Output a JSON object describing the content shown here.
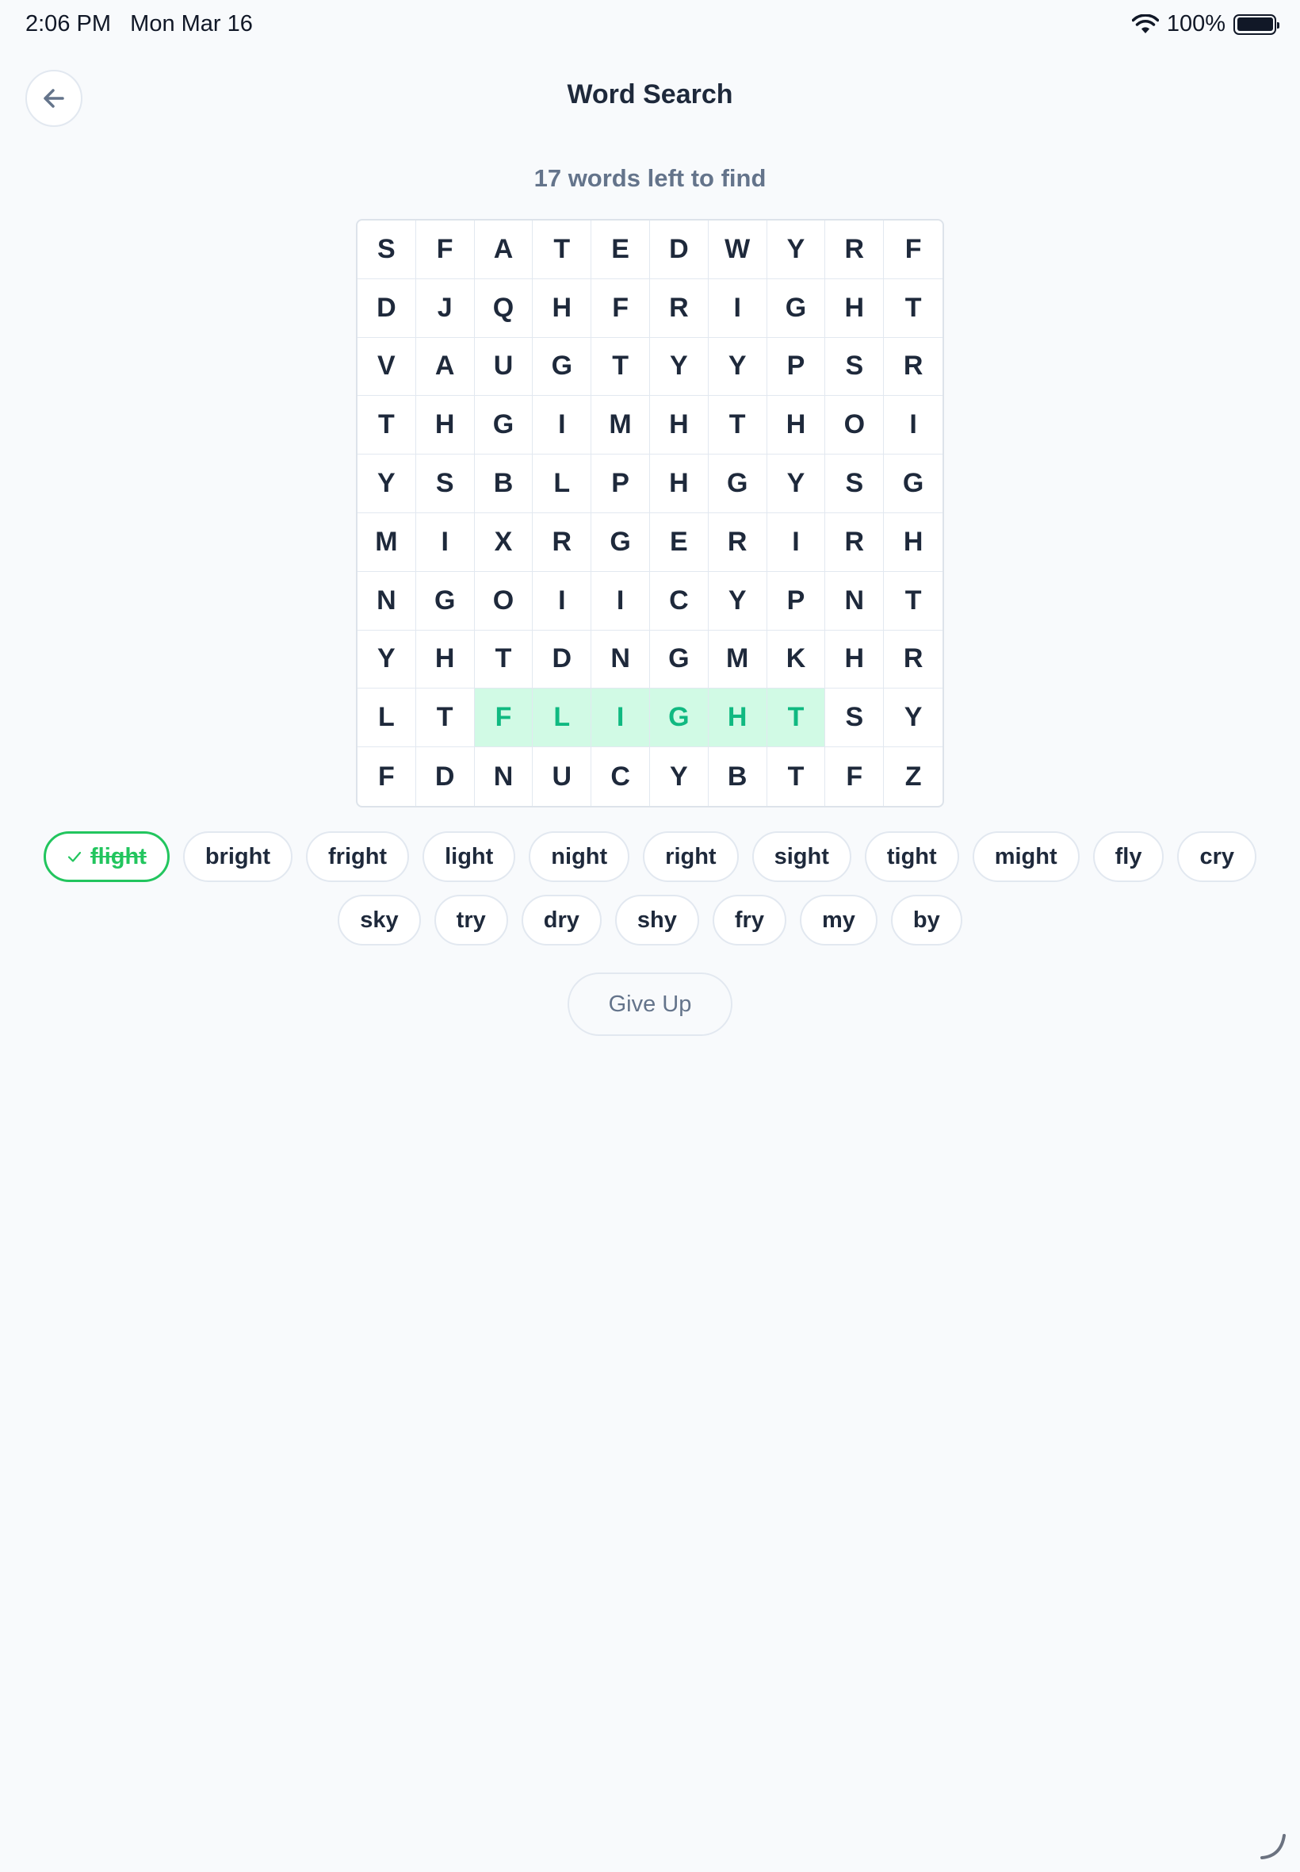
{
  "status_bar": {
    "time": "2:06 PM",
    "date": "Mon Mar 16",
    "battery": "100%"
  },
  "header": {
    "title": "Word Search"
  },
  "progress": {
    "text": "17 words left to find"
  },
  "grid": {
    "rows": [
      [
        "S",
        "F",
        "A",
        "T",
        "E",
        "D",
        "W",
        "Y",
        "R",
        "F"
      ],
      [
        "D",
        "J",
        "Q",
        "H",
        "F",
        "R",
        "I",
        "G",
        "H",
        "T"
      ],
      [
        "V",
        "A",
        "U",
        "G",
        "T",
        "Y",
        "Y",
        "P",
        "S",
        "R"
      ],
      [
        "T",
        "H",
        "G",
        "I",
        "M",
        "H",
        "T",
        "H",
        "O",
        "I"
      ],
      [
        "Y",
        "S",
        "B",
        "L",
        "P",
        "H",
        "G",
        "Y",
        "S",
        "G"
      ],
      [
        "M",
        "I",
        "X",
        "R",
        "G",
        "E",
        "R",
        "I",
        "R",
        "H"
      ],
      [
        "N",
        "G",
        "O",
        "I",
        "I",
        "C",
        "Y",
        "P",
        "N",
        "T"
      ],
      [
        "Y",
        "H",
        "T",
        "D",
        "N",
        "G",
        "M",
        "K",
        "H",
        "R"
      ],
      [
        "L",
        "T",
        "F",
        "L",
        "I",
        "G",
        "H",
        "T",
        "S",
        "Y"
      ],
      [
        "F",
        "D",
        "N",
        "U",
        "C",
        "Y",
        "B",
        "T",
        "F",
        "Z"
      ]
    ],
    "found_highlight": {
      "word": "flight",
      "row": 8,
      "cols": [
        2,
        3,
        4,
        5,
        6,
        7
      ],
      "color": "#d1fae5",
      "text_color": "#10b981"
    }
  },
  "words": [
    {
      "label": "flight",
      "found": true
    },
    {
      "label": "bright",
      "found": false
    },
    {
      "label": "fright",
      "found": false
    },
    {
      "label": "light",
      "found": false
    },
    {
      "label": "night",
      "found": false
    },
    {
      "label": "right",
      "found": false
    },
    {
      "label": "sight",
      "found": false
    },
    {
      "label": "tight",
      "found": false
    },
    {
      "label": "might",
      "found": false
    },
    {
      "label": "fly",
      "found": false
    },
    {
      "label": "cry",
      "found": false
    },
    {
      "label": "sky",
      "found": false
    },
    {
      "label": "try",
      "found": false
    },
    {
      "label": "dry",
      "found": false
    },
    {
      "label": "shy",
      "found": false
    },
    {
      "label": "fry",
      "found": false
    },
    {
      "label": "my",
      "found": false
    },
    {
      "label": "by",
      "found": false
    }
  ],
  "actions": {
    "give_up_label": "Give Up"
  },
  "colors": {
    "found_accent": "#22c55e",
    "background": "#f8fafc",
    "text": "#1e293b",
    "muted": "#64748b"
  },
  "icons": {
    "back": "arrow-left-icon",
    "wifi": "wifi-icon",
    "battery": "battery-icon",
    "check": "check-icon"
  }
}
